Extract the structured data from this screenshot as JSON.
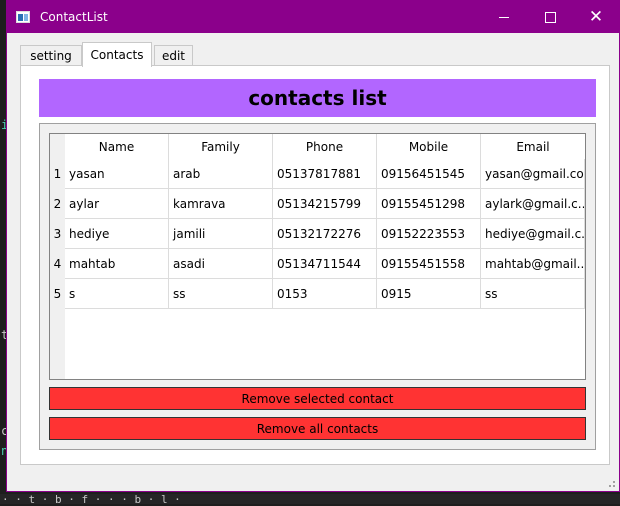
{
  "window": {
    "title": "ContactList",
    "titlebar_color": "#8b008b"
  },
  "tabs": [
    {
      "label": "setting",
      "active": false
    },
    {
      "label": "Contacts",
      "active": true
    },
    {
      "label": "edit",
      "active": false
    }
  ],
  "contacts_tab": {
    "heading": "contacts list",
    "heading_color": "#b266ff",
    "table": {
      "columns": [
        "Name",
        "Family",
        "Phone",
        "Mobile",
        "Email"
      ],
      "rows": [
        {
          "num": "1",
          "cells": [
            "yasan",
            "arab",
            "05137817881",
            "09156451545",
            "yasan@gmail.co..."
          ]
        },
        {
          "num": "2",
          "cells": [
            "aylar",
            "kamrava",
            "05134215799",
            "09155451298",
            "aylark@gmail.c..."
          ]
        },
        {
          "num": "3",
          "cells": [
            "hediye",
            "jamili",
            "05132172276",
            "09152223553",
            "hediye@gmail.c..."
          ]
        },
        {
          "num": "4",
          "cells": [
            "mahtab",
            "asadi",
            "05134711544",
            "09155451558",
            "mahtab@gmail...."
          ]
        },
        {
          "num": "5",
          "cells": [
            "s",
            "ss",
            "0153",
            "0915",
            "ss"
          ]
        }
      ]
    },
    "remove_selected_label": "Remove selected contact",
    "remove_all_label": "Remove all contacts",
    "button_color": "#ff3333"
  },
  "background": {
    "left_glyphs": [
      "i",
      "t",
      "c",
      "n"
    ],
    "bottom_text": "· · t · b · f · · · b · l ·"
  }
}
